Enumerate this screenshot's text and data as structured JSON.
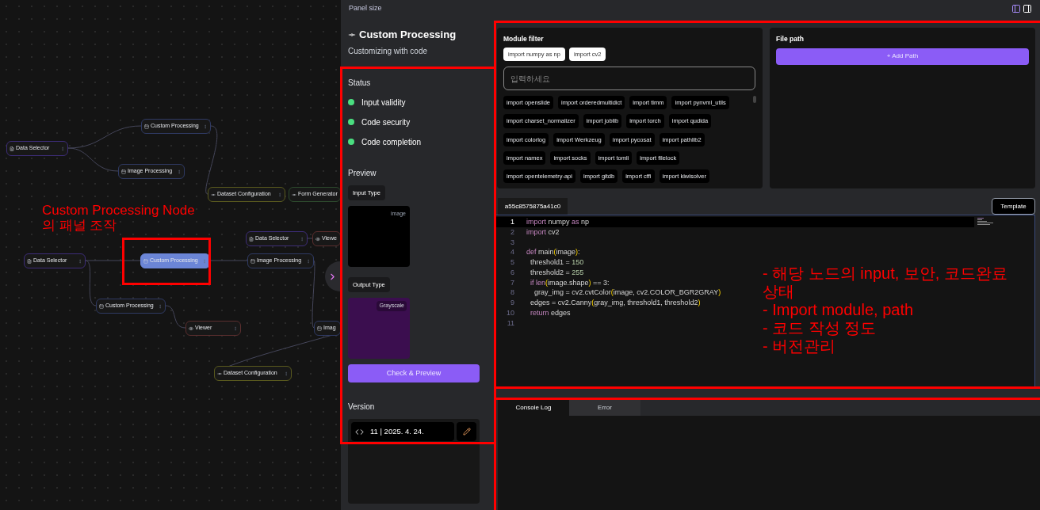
{
  "canvas": {
    "nodes": [
      {
        "label": "Data Selector",
        "kind": "data",
        "selected": false
      },
      {
        "label": "Custom Processing",
        "kind": "process",
        "selected": false
      },
      {
        "label": "Image Processing",
        "kind": "process",
        "selected": false
      },
      {
        "label": "Dataset Configuration",
        "kind": "dataset",
        "selected": false
      },
      {
        "label": "Form Generator",
        "kind": "form",
        "selected": false
      },
      {
        "label": "Data Selector",
        "kind": "data",
        "selected": false
      },
      {
        "label": "Viewe",
        "kind": "viewer",
        "selected": false
      },
      {
        "label": "Data Selector",
        "kind": "data",
        "selected": false
      },
      {
        "label": "Custom Processing",
        "kind": "process",
        "selected": true
      },
      {
        "label": "Image Processing",
        "kind": "process",
        "selected": false
      },
      {
        "label": "Custom Processing",
        "kind": "process",
        "selected": false
      },
      {
        "label": "Viewer",
        "kind": "viewer",
        "selected": false
      },
      {
        "label": "Imag",
        "kind": "process",
        "selected": false
      },
      {
        "label": "Dataset Configuration",
        "kind": "dataset",
        "selected": false
      }
    ]
  },
  "top_bar": {
    "label": "Panel size"
  },
  "panel": {
    "title": "Custom Processing",
    "subtitle": "Customizing with code",
    "status_title": "Status",
    "status": [
      {
        "label": "Input validity",
        "passed": true
      },
      {
        "label": "Code security",
        "passed": true
      },
      {
        "label": "Code completion",
        "passed": true
      }
    ],
    "preview_title": "Preview",
    "input_type": "Input Type",
    "input_badge": "image",
    "output_type": "Output Type",
    "output_badge": "Grayscale",
    "check_button": "Check & Preview",
    "version_title": "Version",
    "version": "11 | 2025. 4. 24."
  },
  "module_filter": {
    "title": "Module filter",
    "selected": [
      "import numpy as np",
      "import cv2"
    ],
    "placeholder": "입력하세요",
    "modules": [
      "import openslide",
      "import orderedmultidict",
      "import timm",
      "import pynvml_utils",
      "import charset_normalizer",
      "import joblib",
      "import torch",
      "import qudida",
      "import colorlog",
      "import Werkzeug",
      "import pycosat",
      "import pathlib2",
      "import namex",
      "import socks",
      "import tomli",
      "import filelock",
      "import opentelemetry-api",
      "import gitdb",
      "import cffi",
      "import kiwisolver"
    ]
  },
  "file_path": {
    "title": "File path",
    "button": "+ Add Path"
  },
  "editor": {
    "tab": "a55c8575875a41c0",
    "template_button": "Template",
    "lines": [
      {
        "n": "1",
        "tokens": [
          {
            "text": "import",
            "kind": "keyword"
          },
          {
            "text": " numpy ",
            "kind": "plain"
          },
          {
            "text": "as",
            "kind": "keyword"
          },
          {
            "text": " np",
            "kind": "plain"
          }
        ]
      },
      {
        "n": "2",
        "tokens": [
          {
            "text": "import",
            "kind": "keyword"
          },
          {
            "text": " cv2",
            "kind": "plain"
          }
        ]
      },
      {
        "n": "3"
      },
      {
        "n": "4",
        "tokens": [
          {
            "text": "def",
            "kind": "keyword"
          },
          {
            "text": " main",
            "kind": "plain"
          },
          {
            "text": "(",
            "kind": "paren"
          },
          {
            "text": "image",
            "kind": "plain"
          },
          {
            "text": ")",
            "kind": "paren"
          },
          {
            "text": ":",
            "kind": "plain"
          }
        ]
      },
      {
        "n": "5",
        "tokens": [
          {
            "text": "  threshold1 = ",
            "kind": "plain"
          },
          {
            "text": "150",
            "kind": "number"
          }
        ]
      },
      {
        "n": "6",
        "tokens": [
          {
            "text": "  threshold2 = ",
            "kind": "plain"
          },
          {
            "text": "255",
            "kind": "number"
          }
        ]
      },
      {
        "n": "7",
        "tokens": [
          {
            "text": "  if len",
            "kind": "keyword"
          },
          {
            "text": "(",
            "kind": "paren"
          },
          {
            "text": "image.shape",
            "kind": "plain"
          },
          {
            "text": ")",
            "kind": "paren"
          },
          {
            "text": " == 3:",
            "kind": "plain"
          }
        ]
      },
      {
        "n": "8",
        "tokens": [
          {
            "text": "    gray_img = cv2.cvtColor",
            "kind": "plain"
          },
          {
            "text": "(",
            "kind": "paren"
          },
          {
            "text": "image, cv2.COLOR_BGR2GRAY",
            "kind": "plain"
          },
          {
            "text": ")",
            "kind": "paren"
          }
        ]
      },
      {
        "n": "9",
        "tokens": [
          {
            "text": "  edges = cv2.Canny",
            "kind": "plain"
          },
          {
            "text": "(",
            "kind": "paren"
          },
          {
            "text": "gray_img, threshold1, threshold2",
            "kind": "plain"
          },
          {
            "text": ")",
            "kind": "paren"
          }
        ]
      },
      {
        "n": "10",
        "tokens": [
          {
            "text": "  return",
            "kind": "keyword"
          },
          {
            "text": " edges",
            "kind": "plain"
          }
        ]
      },
      {
        "n": "11"
      }
    ]
  },
  "console": {
    "tabs": [
      {
        "label": "Console Log",
        "selected": true
      },
      {
        "label": "Error",
        "selected": false
      }
    ]
  },
  "annotations": {
    "canvas_note": "Custom Processing Node의 패널 조작",
    "notes": [
      "- 해당 노드의 input, 보안, 코드완료상태",
      "- Import module, path",
      "- 코드 작성 정도",
      "- 버전관리"
    ]
  }
}
